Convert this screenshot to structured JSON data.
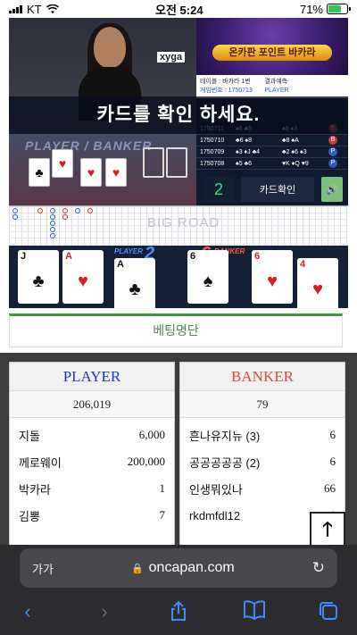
{
  "status_bar": {
    "carrier": "KT",
    "time": "오전 5:24",
    "battery": "71%"
  },
  "game": {
    "logo_tag": "xyga",
    "table_labels": [
      "PLAYER",
      "BANKER"
    ],
    "banner_title": "온카판 포인트 바카라",
    "info_table": "테이블 : 바카라 1번",
    "info_result_label": "결과예측",
    "info_round": "게임번호 : 1750713",
    "info_player": "PLAYER",
    "overlay_message": "카드를 확인 하세요.",
    "history": [
      {
        "round": "1750711",
        "player": "♠6 ♣5 ",
        "banker": "♠8 ♦3",
        "result": "B"
      },
      {
        "round": "1750710",
        "player": "♣6 ♠8",
        "banker": "♣8 ♠A",
        "result": "B"
      },
      {
        "round": "1750709",
        "player": "♠3 ♦J ♣4",
        "banker": "♣2 ♠6 ♠3",
        "result": "P"
      },
      {
        "round": "1750708",
        "player": "♠5 ♣6",
        "banker": "♥K ♦Q ♥9",
        "result": "P"
      }
    ],
    "card_count": "2",
    "card_check_label": "카드확인",
    "big_road_label": "BIG ROAD",
    "player_label": "PLAYER",
    "player_score": "2",
    "banker_label": "BANKER",
    "banker_score": "6",
    "player_cards": [
      {
        "rank": "J",
        "suit": "♣"
      },
      {
        "rank": "A",
        "suit": "♥"
      },
      {
        "rank": "A",
        "suit": "♣"
      }
    ],
    "banker_cards": [
      {
        "rank": "6",
        "suit": "♠"
      },
      {
        "rank": "6",
        "suit": "♥"
      },
      {
        "rank": "4",
        "suit": "♥"
      }
    ]
  },
  "betting": {
    "tab_label": "베팅명단",
    "player": {
      "header": "PLAYER",
      "total": "206,019",
      "rows": [
        {
          "name": "지돌",
          "amount": "6,000"
        },
        {
          "name": "께로웨이",
          "amount": "200,000"
        },
        {
          "name": "박카라",
          "amount": "1"
        },
        {
          "name": "김뽕",
          "amount": "7"
        }
      ]
    },
    "banker": {
      "header": "BANKER",
      "total": "79",
      "rows": [
        {
          "name": "흔나유지뉴 (3)",
          "amount": "6"
        },
        {
          "name": "공공공공공 (2)",
          "amount": "6"
        },
        {
          "name": "인생뭐있나",
          "amount": "66"
        },
        {
          "name": "rkdmfdl12",
          "amount": "1"
        }
      ]
    }
  },
  "safari": {
    "text_size_label": "가가",
    "url": "oncapan.com"
  },
  "icons": [
    "wifi-icon",
    "battery-icon",
    "lock-icon",
    "reload-icon",
    "back-icon",
    "forward-icon",
    "share-icon",
    "bookmarks-icon",
    "tabs-icon",
    "scroll-top-icon",
    "sound-icon"
  ]
}
